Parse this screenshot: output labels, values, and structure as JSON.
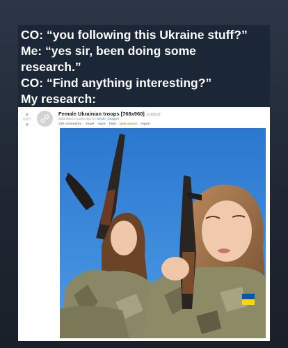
{
  "caption": {
    "lines": [
      "CO: “you following this Ukraine stuff?”",
      "Me: “yes sir, been doing some",
      "research.”",
      "CO: “Find anything interesting?”",
      "My research:"
    ]
  },
  "post": {
    "score": "6007",
    "title": "Female Ukrainian troops [768x960]",
    "domain": "(i.redd.it)",
    "submitted": "submitted 3 years ago by",
    "author": "Strafe_Stopper",
    "links": [
      "235 comments",
      "share",
      "save",
      "hide",
      "give award",
      "report"
    ]
  },
  "colors": {
    "background": "#1f2733",
    "caption_bg": "#1b2636",
    "sky": "#2f7fd1",
    "flag_blue": "#0057b7",
    "flag_yellow": "#ffd700"
  }
}
